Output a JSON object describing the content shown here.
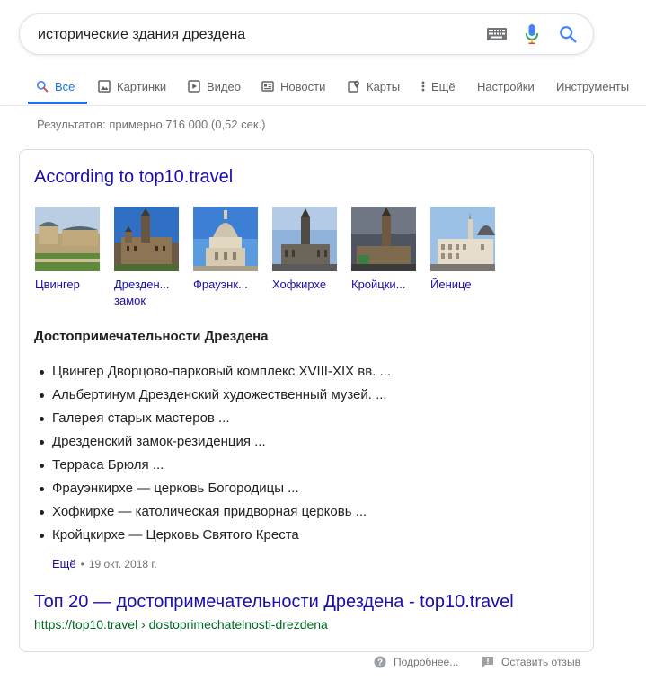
{
  "search": {
    "query": "исторические здания дрездена",
    "keyboard_icon": "keyboard-icon",
    "mic_icon": "microphone-icon",
    "search_icon": "search-icon"
  },
  "tabs": [
    {
      "label": "Все",
      "icon": "search-icon",
      "active": true
    },
    {
      "label": "Картинки",
      "icon": "image-icon"
    },
    {
      "label": "Видео",
      "icon": "play-icon"
    },
    {
      "label": "Новости",
      "icon": "news-icon"
    },
    {
      "label": "Карты",
      "icon": "map-pin-icon"
    },
    {
      "label": "Ещё",
      "icon": "more-vert-icon"
    },
    {
      "label": "Настройки"
    },
    {
      "label": "Инструменты"
    }
  ],
  "result_stats": "Результатов: примерно 716 000 (0,52 сек.)",
  "card": {
    "title": "According to top10.travel",
    "images": [
      {
        "caption": "Цвингер"
      },
      {
        "caption": "Дрезден...",
        "caption2": "замок"
      },
      {
        "caption": "Фрауэнк..."
      },
      {
        "caption": "Хофкирхе"
      },
      {
        "caption": "Кройцки..."
      },
      {
        "caption": "Йенице"
      }
    ],
    "heading": "Достопримечательности Дрездена",
    "items": [
      "Цвингер Дворцово-парковый комплекс XVIII-XIX вв. ...",
      "Альбертинум Дрезденский художественный музей. ...",
      "Галерея старых мастеров ...",
      "Дрезденский замок-резиденция ...",
      "Терраса Брюля ...",
      "Фрауэнкирхе — церковь Богородицы ...",
      "Хофкирхе — католическая придворная церковь ...",
      "Кройцкирхе — Церковь Святого Креста"
    ],
    "more_label": "Ещё",
    "date": "19 окт. 2018 г.",
    "result_title": "Топ 20 — достопримечательности Дрездена - top10.travel",
    "result_url": "https://top10.travel › dostoprimechatelnosti-drezdena"
  },
  "footer": {
    "about": "Подробнее...",
    "feedback": "Оставить отзыв"
  },
  "colors": {
    "link": "#1a0dab",
    "accent": "#1a73e8",
    "url_green": "#006621",
    "muted": "#70757a"
  }
}
